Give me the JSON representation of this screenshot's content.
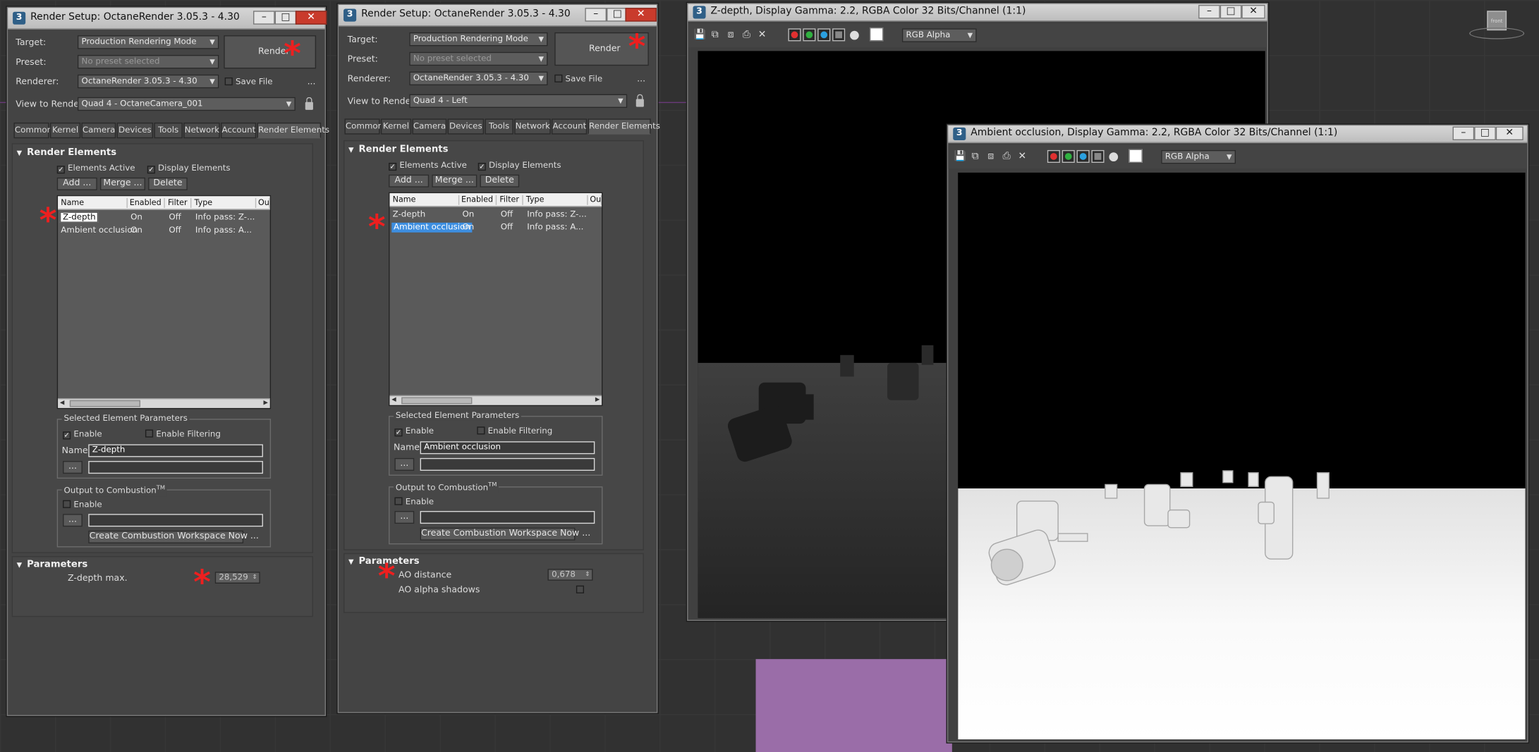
{
  "window1": {
    "title": "Render Setup: OctaneRender 3.05.3 - 4.30",
    "target_label": "Target:",
    "target_value": "Production Rendering Mode",
    "preset_label": "Preset:",
    "preset_value": "No preset selected",
    "renderer_label": "Renderer:",
    "renderer_value": "OctaneRender 3.05.3 - 4.30",
    "save_file": "Save File",
    "more": "...",
    "view_label": "View to Render:",
    "view_value": "Quad 4 - OctaneCamera_001",
    "render_button": "Render",
    "tabs": [
      "Common",
      "Kernel",
      "Camera",
      "Devices",
      "Tools",
      "Network",
      "Account",
      "Render Elements"
    ],
    "rollout_title": "Render Elements",
    "elements_active": "Elements Active",
    "display_elements": "Display Elements",
    "add": "Add ...",
    "merge": "Merge ...",
    "delete": "Delete",
    "columns": [
      "Name",
      "Enabled",
      "Filter",
      "Type",
      "Ou"
    ],
    "rows": [
      {
        "name": "Z-depth",
        "enabled": "On",
        "filter": "Off",
        "type": "Info pass: Z-..."
      },
      {
        "name": "Ambient occlusion",
        "enabled": "On",
        "filter": "Off",
        "type": "Info pass: A..."
      }
    ],
    "sel_params": "Selected Element Parameters",
    "enable": "Enable",
    "enable_filtering": "Enable Filtering",
    "name_label": "Name:",
    "name_value": "Z-depth",
    "browse": "...",
    "output_combustion": "Output to Combustion",
    "tm": "TM",
    "combustion_enable": "Enable",
    "create_workspace": "Create Combustion Workspace Now ...",
    "params_title": "Parameters",
    "zdepth_label": "Z-depth max.",
    "zdepth_value": "28,529"
  },
  "window2": {
    "title": "Render Setup: OctaneRender 3.05.3 - 4.30",
    "target_label": "Target:",
    "target_value": "Production Rendering Mode",
    "preset_label": "Preset:",
    "preset_value": "No preset selected",
    "renderer_label": "Renderer:",
    "renderer_value": "OctaneRender 3.05.3 - 4.30",
    "save_file": "Save File",
    "more": "...",
    "view_label": "View to Render:",
    "view_value": "Quad 4 - Left",
    "render_button": "Render",
    "tabs": [
      "Common",
      "Kernel",
      "Camera",
      "Devices",
      "Tools",
      "Network",
      "Account",
      "Render Elements"
    ],
    "rollout_title": "Render Elements",
    "elements_active": "Elements Active",
    "display_elements": "Display Elements",
    "add": "Add ...",
    "merge": "Merge ...",
    "delete": "Delete",
    "columns": [
      "Name",
      "Enabled",
      "Filter",
      "Type",
      "Ou"
    ],
    "rows": [
      {
        "name": "Z-depth",
        "enabled": "On",
        "filter": "Off",
        "type": "Info pass: Z-..."
      },
      {
        "name": "Ambient occlusion",
        "enabled": "On",
        "filter": "Off",
        "type": "Info pass: A..."
      }
    ],
    "sel_params": "Selected Element Parameters",
    "enable": "Enable",
    "enable_filtering": "Enable Filtering",
    "name_label": "Name:",
    "name_value": "Ambient occlusion",
    "browse": "...",
    "output_combustion": "Output to Combustion",
    "tm": "TM",
    "combustion_enable": "Enable",
    "create_workspace": "Create Combustion Workspace Now ...",
    "params_title": "Parameters",
    "ao_distance_label": "AO distance",
    "ao_distance_value": "0,678",
    "ao_alpha_label": "AO alpha shadows"
  },
  "fb1": {
    "title": "Z-depth, Display Gamma: 2.2, RGBA Color 32 Bits/Channel (1:1)",
    "channel": "RGB Alpha"
  },
  "fb2": {
    "title": "Ambient occlusion, Display Gamma: 2.2, RGBA Color 32 Bits/Channel (1:1)",
    "channel": "RGB Alpha"
  },
  "viewcube_label": "front",
  "colors": {
    "annotation": "#ee1f1f",
    "selection": "#3d8ee0",
    "viewport_accent": "#9a6da8"
  }
}
